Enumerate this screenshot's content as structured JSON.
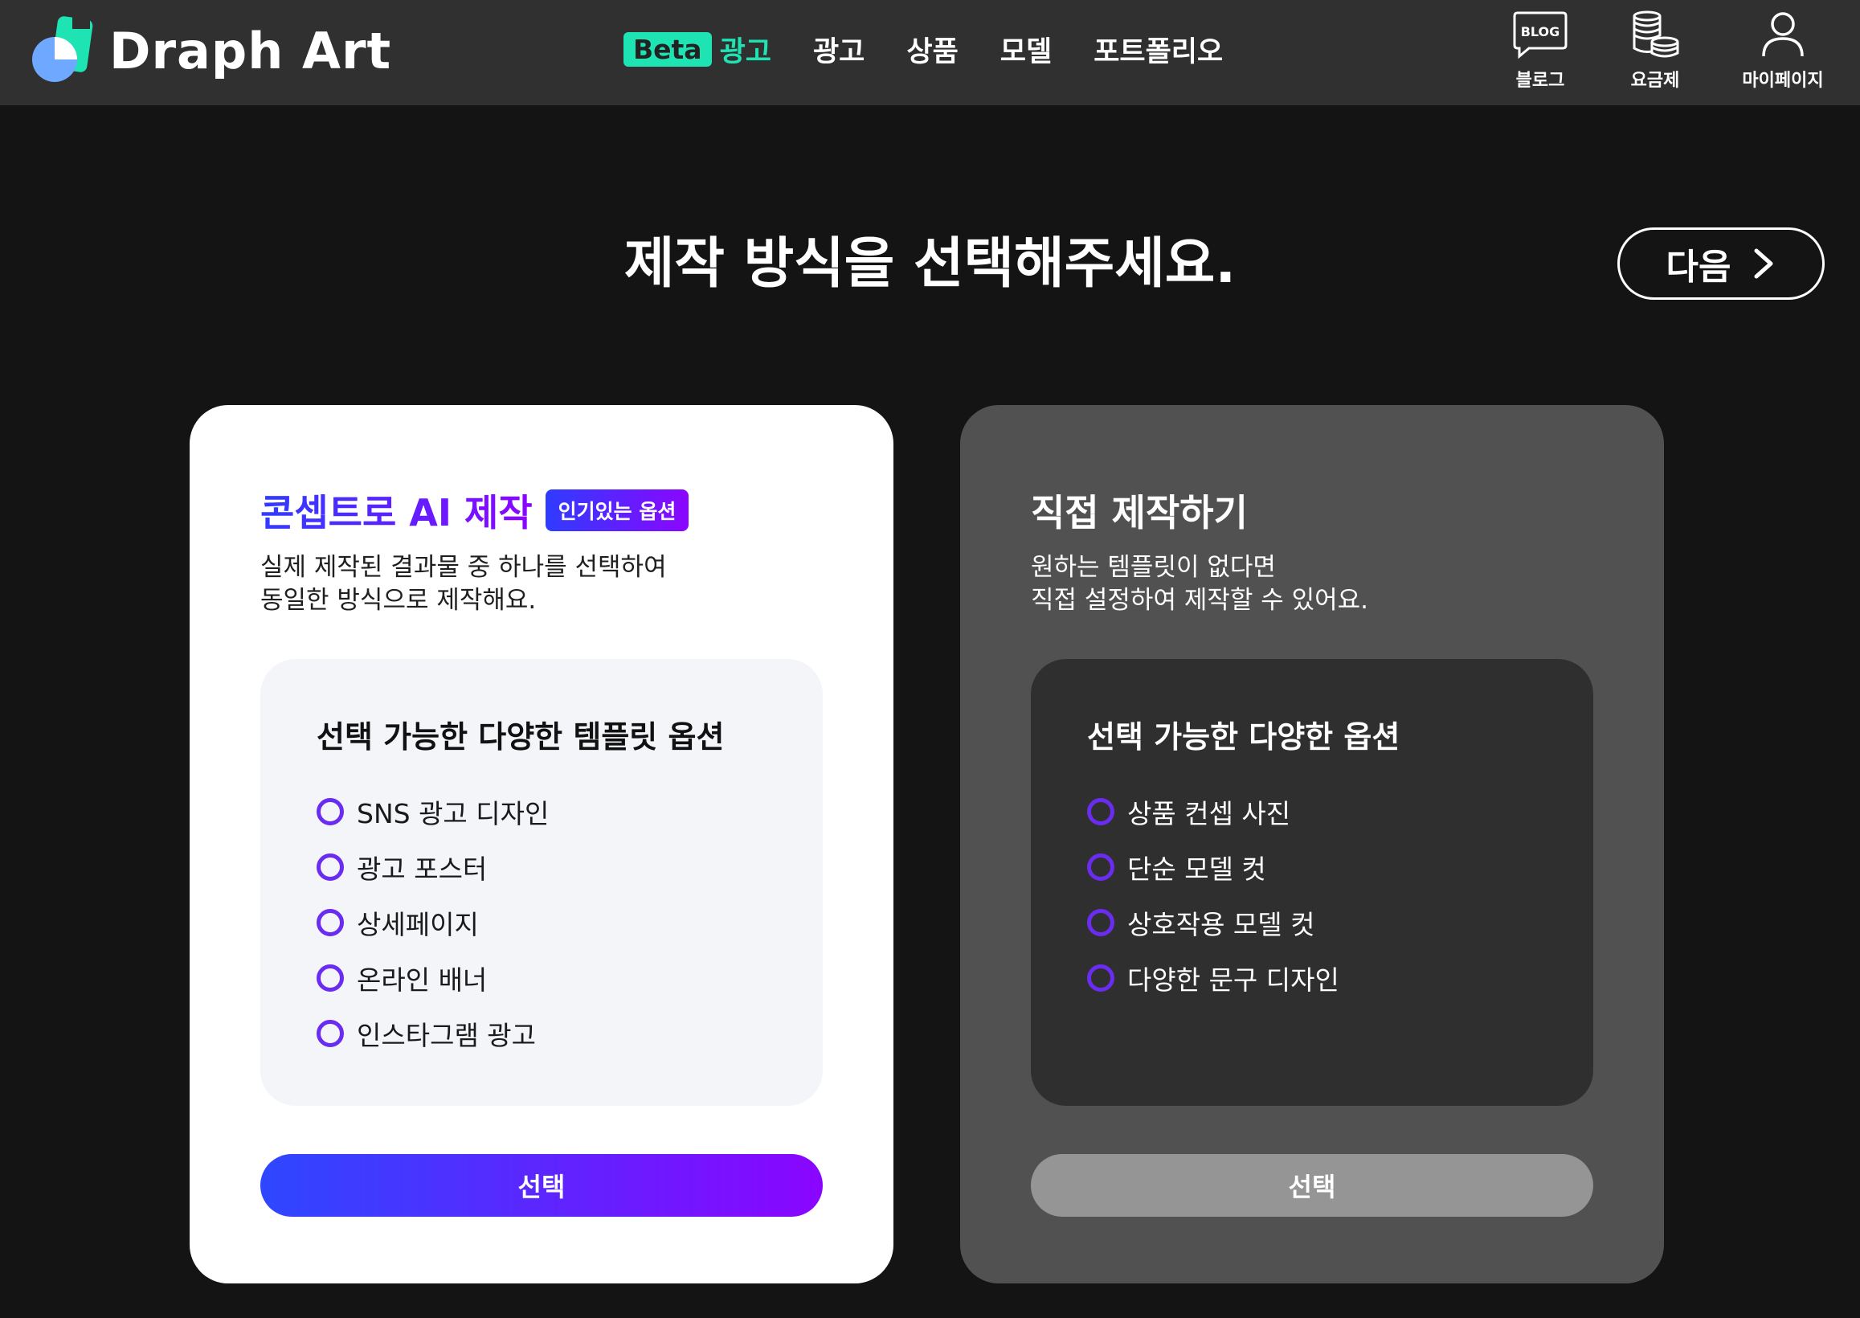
{
  "header": {
    "logo_text": "Draph Art",
    "nav": [
      {
        "badge": "Beta",
        "label": "광고"
      },
      {
        "label": "광고"
      },
      {
        "label": "상품"
      },
      {
        "label": "모델"
      },
      {
        "label": "포트폴리오"
      }
    ],
    "utilities": [
      {
        "label": "블로그",
        "icon": "blog-icon",
        "icon_text": "BLOG"
      },
      {
        "label": "요금제",
        "icon": "coins-icon"
      },
      {
        "label": "마이페이지",
        "icon": "user-icon"
      }
    ]
  },
  "page": {
    "title": "제작 방식을 선택해주세요.",
    "next_label": "다음"
  },
  "cards": [
    {
      "title": "콘셉트로 AI 제작",
      "badge": "인기있는 옵션",
      "desc_line1": "실제 제작된 결과물 중 하나를 선택하여",
      "desc_line2": "동일한 방식으로 제작해요.",
      "options_title": "선택 가능한 다양한 템플릿 옵션",
      "options": [
        "SNS 광고 디자인",
        "광고 포스터",
        "상세페이지",
        "온라인 배너",
        "인스타그램 광고"
      ],
      "button_label": "선택"
    },
    {
      "title": "직접 제작하기",
      "desc_line1": "원하는 템플릿이 없다면",
      "desc_line2": "직접 설정하여 제작할 수 있어요.",
      "options_title": "선택 가능한 다양한 옵션",
      "options": [
        "상품 컨셉 사진",
        "단순 모델 컷",
        "상호작용 모델 컷",
        "다양한 문구 디자인"
      ],
      "button_label": "선택"
    }
  ],
  "colors": {
    "accent_mint": "#1ee3b2",
    "gradient_start": "#2f3cff",
    "gradient_end": "#8b06ff",
    "radio_ring": "#6a2cf0"
  }
}
